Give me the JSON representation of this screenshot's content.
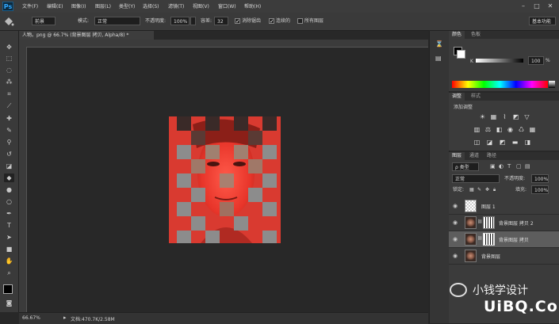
{
  "app": {
    "logo": "Ps"
  },
  "menu": [
    "文件(F)",
    "编辑(E)",
    "图像(I)",
    "图层(L)",
    "类型(Y)",
    "选择(S)",
    "滤镜(T)",
    "视图(V)",
    "窗口(W)",
    "帮助(H)"
  ],
  "window_controls": {
    "minimize": "–",
    "maximize": "□",
    "close": "✕"
  },
  "options": {
    "fill_source": "前景",
    "mode_label": "模式:",
    "mode_value": "正常",
    "opacity_label": "不透明度:",
    "opacity_value": "100%",
    "tolerance_label": "容差:",
    "tolerance_value": "32",
    "antialias_label": "消除锯齿",
    "antialias_checked": true,
    "contiguous_label": "连续的",
    "contiguous_checked": true,
    "all_layers_label": "所有图层",
    "all_layers_checked": false,
    "workspace": "基本功能"
  },
  "document": {
    "tab_title": "人物。png @ 66.7% (背景图层 拷贝, Alpha/8) *",
    "zoom": "66.67%",
    "doc_size": "文档:470.7K/2.58M"
  },
  "color_panel": {
    "tabs": [
      "颜色",
      "色板"
    ],
    "channel_label": "K",
    "value": "100",
    "unit": "%"
  },
  "adjustments_panel": {
    "tabs": [
      "调整",
      "样式"
    ],
    "add_label": "添加调整"
  },
  "layers_panel": {
    "tabs": [
      "图层",
      "通道",
      "路径"
    ],
    "filter_label": "ρ 类型",
    "blend_mode": "正常",
    "opacity_label": "不透明度:",
    "opacity_value": "100%",
    "lock_label": "锁定:",
    "fill_label": "填充:",
    "fill_value": "100%",
    "layers": [
      {
        "name": "图层 1",
        "selected": false
      },
      {
        "name": "背景图层 拷贝 2",
        "selected": false
      },
      {
        "name": "背景图层 拷贝",
        "selected": true
      },
      {
        "name": "背景图层",
        "selected": false
      }
    ]
  },
  "watermark": {
    "text": "小钱学设计",
    "logo": "UiBQ.CoM"
  },
  "colors": {
    "accent_red": "#d93a30",
    "checker_gray": "#9a9a9a",
    "ps_blue": "#31a8ff"
  }
}
